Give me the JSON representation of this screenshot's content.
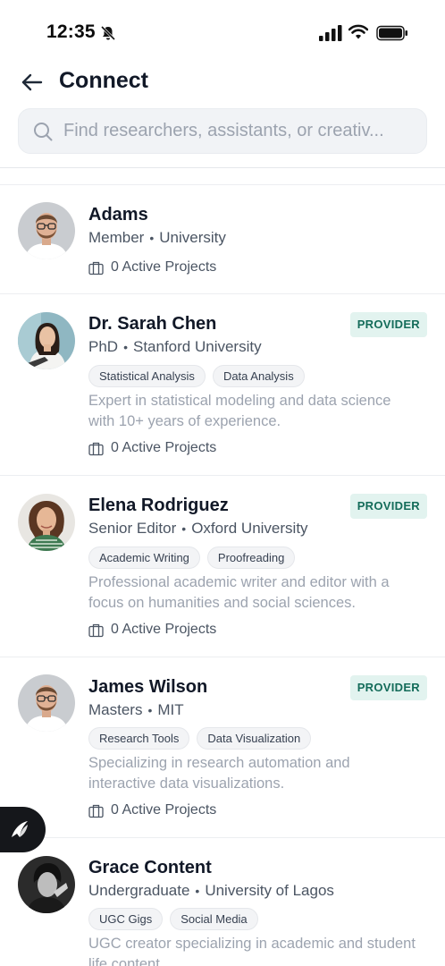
{
  "status_bar": {
    "time": "12:35"
  },
  "header": {
    "title": "Connect"
  },
  "search": {
    "placeholder": "Find researchers, assistants, or creativ..."
  },
  "users": [
    {
      "name": "Adams",
      "role": "Member",
      "institution": "University",
      "badge": "",
      "tags": [],
      "description": "",
      "projects": "0 Active Projects"
    },
    {
      "name": "Dr. Sarah Chen",
      "role": "PhD",
      "institution": "Stanford University",
      "badge": "PROVIDER",
      "tags": [
        "Statistical Analysis",
        "Data Analysis"
      ],
      "description": "Expert in statistical modeling and data science with 10+ years of experience.",
      "projects": "0 Active Projects"
    },
    {
      "name": "Elena Rodriguez",
      "role": "Senior Editor",
      "institution": "Oxford University",
      "badge": "PROVIDER",
      "tags": [
        "Academic Writing",
        "Proofreading"
      ],
      "description": "Professional academic writer and editor with a focus on humanities and social sciences.",
      "projects": "0 Active Projects"
    },
    {
      "name": "James Wilson",
      "role": "Masters",
      "institution": "MIT",
      "badge": "PROVIDER",
      "tags": [
        "Research Tools",
        "Data Visualization"
      ],
      "description": "Specializing in research automation and interactive data visualizations.",
      "projects": "0 Active Projects"
    },
    {
      "name": "Grace Content",
      "role": "Undergraduate",
      "institution": "University of Lagos",
      "badge": "",
      "tags": [
        "UGC Gigs",
        "Social Media"
      ],
      "description": "UGC creator specializing in academic and student life content.",
      "projects": ""
    }
  ],
  "icons": {
    "back": "arrow-left-icon",
    "search": "search-icon",
    "projects": "briefcase-icon",
    "fab": "assistant-logo-icon"
  },
  "colors": {
    "badge_bg": "#e2f3ef",
    "badge_text": "#146c5a",
    "fab_bg": "#15171b"
  }
}
